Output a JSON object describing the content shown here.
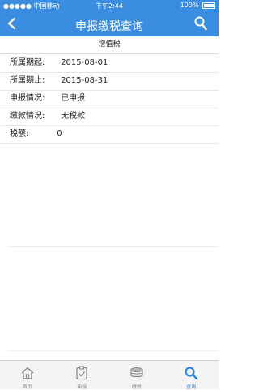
{
  "status_bar": {
    "carrier": "●●●●● 中国移动",
    "time": "下午2:44",
    "battery": "100%"
  },
  "nav": {
    "title": "申报缴税查询",
    "back_icon": "chevron-left-icon",
    "search_icon": "search-icon"
  },
  "section_title": "增值税",
  "fields": [
    {
      "label": "所属期起:",
      "value": "2015-08-01"
    },
    {
      "label": "所属期止:",
      "value": "2015-08-31"
    },
    {
      "label": "申报情况:",
      "value": "已申报"
    },
    {
      "label": "缴款情况:",
      "value": "无税款"
    },
    {
      "label": "税额:",
      "value": "0"
    }
  ],
  "tabs": [
    {
      "label": "首页",
      "icon": "home-icon",
      "active": false
    },
    {
      "label": "申报",
      "icon": "clipboard-check-icon",
      "active": false
    },
    {
      "label": "缴税",
      "icon": "coin-stack-icon",
      "active": false
    },
    {
      "label": "查询",
      "icon": "search-icon",
      "active": true
    }
  ],
  "colors": {
    "accent": "#3a8de0",
    "tab_active": "#2f86e8",
    "tab_inactive": "#8a8a8a"
  }
}
